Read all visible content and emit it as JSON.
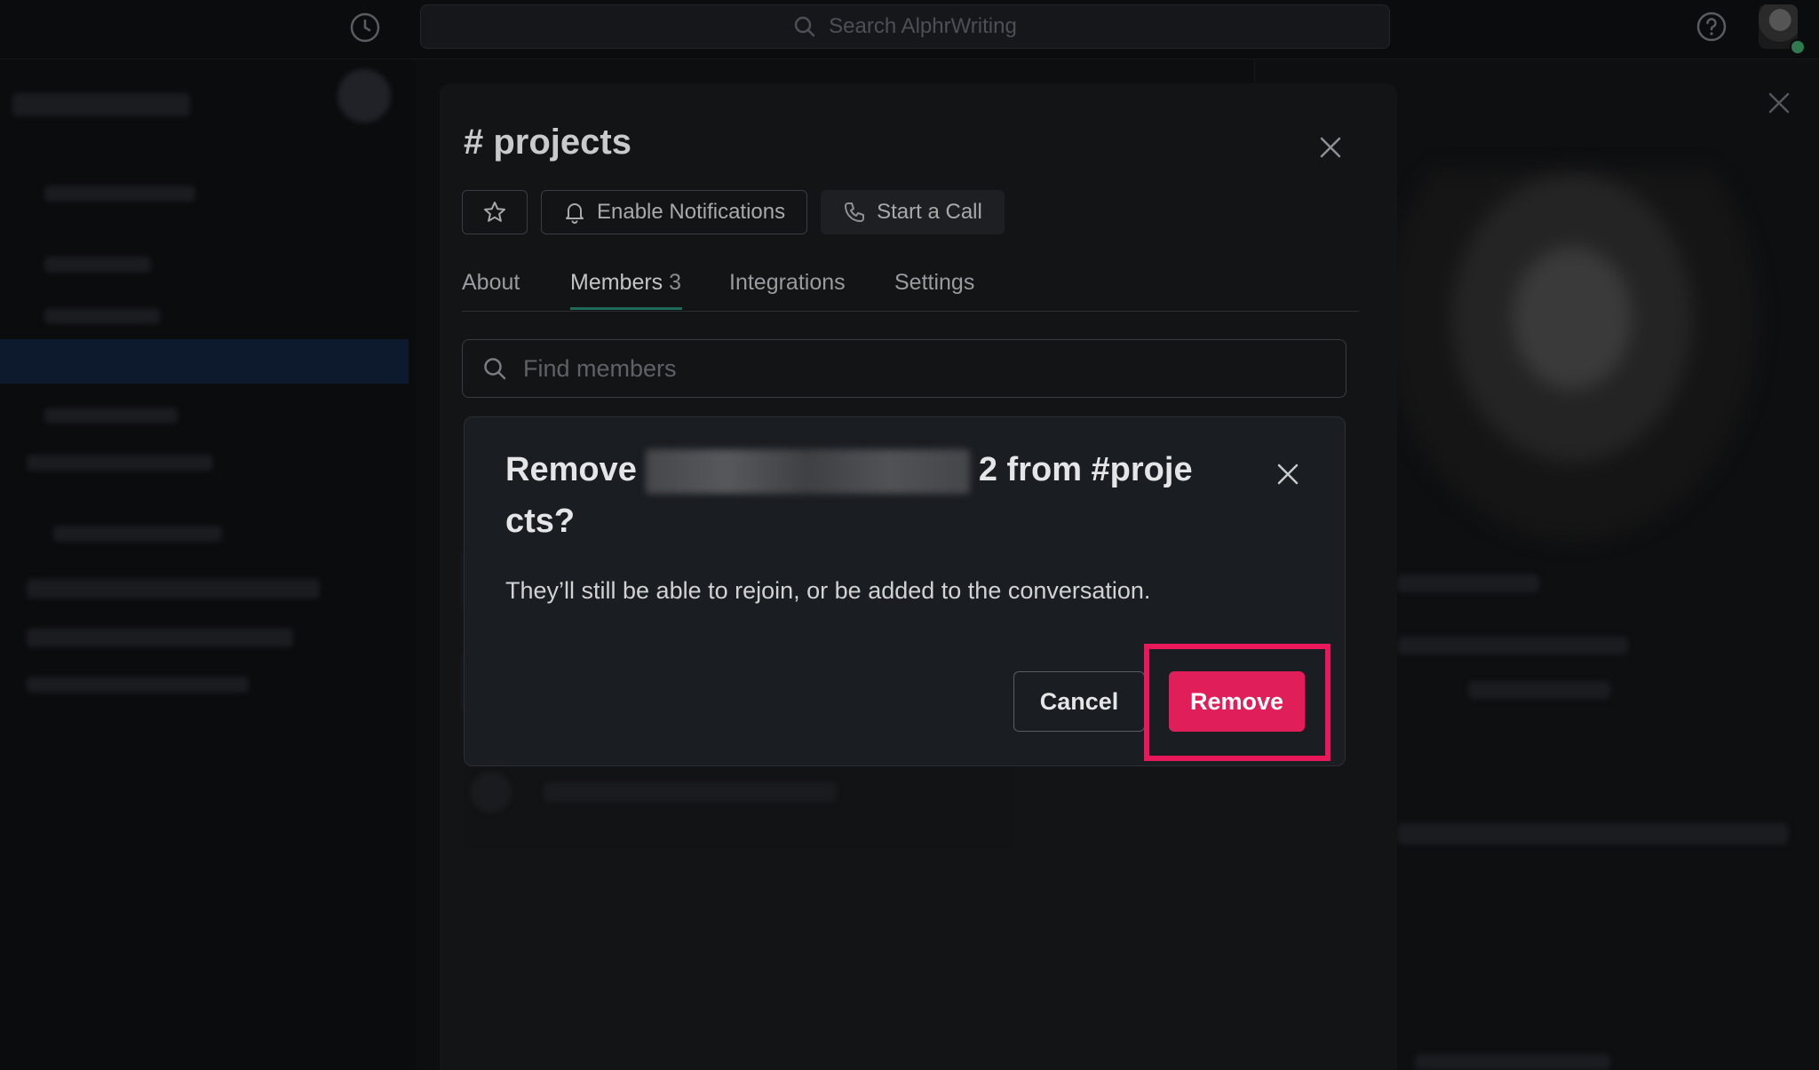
{
  "topbar": {
    "search_placeholder": "Search AlphrWriting",
    "history_icon": "clock-icon",
    "help_icon": "help-circle-icon"
  },
  "channel": {
    "title": "# projects",
    "buttons": {
      "notifications": "Enable Notifications",
      "call": "Start a Call"
    },
    "tabs": [
      {
        "label": "About"
      },
      {
        "label": "Members",
        "count": "3"
      },
      {
        "label": "Integrations"
      },
      {
        "label": "Settings"
      }
    ],
    "find_placeholder": "Find members"
  },
  "dialog": {
    "title_prefix": "Remove",
    "title_suffix": "2 from #proje cts?",
    "body": "They’ll still be able to rejoin, or be added to the conversation.",
    "cancel_label": "Cancel",
    "remove_label": "Remove"
  },
  "colors": {
    "remove_button": "#e01e5a",
    "highlight_box": "#e8185a",
    "background": "#0d0e10"
  }
}
